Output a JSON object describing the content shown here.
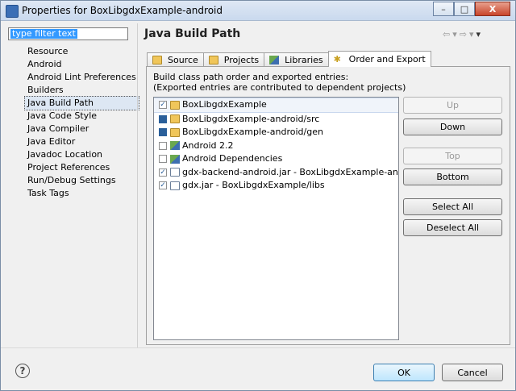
{
  "window": {
    "title": "Properties for BoxLibgdxExample-android",
    "controls": {
      "minimize": "–",
      "maximize": "□",
      "close": "X"
    }
  },
  "filter": {
    "value": "type filter text"
  },
  "nav": {
    "items": [
      {
        "label": "Resource"
      },
      {
        "label": "Android"
      },
      {
        "label": "Android Lint Preferences"
      },
      {
        "label": "Builders"
      },
      {
        "label": "Java Build Path",
        "selected": true
      },
      {
        "label": "Java Code Style"
      },
      {
        "label": "Java Compiler"
      },
      {
        "label": "Java Editor"
      },
      {
        "label": "Javadoc Location"
      },
      {
        "label": "Project References"
      },
      {
        "label": "Run/Debug Settings"
      },
      {
        "label": "Task Tags"
      }
    ]
  },
  "page": {
    "title": "Java Build Path",
    "history": {
      "back": "⇦",
      "back_menu": "▾",
      "forward": "⇨",
      "forward_menu": "▾",
      "view_menu": "▾"
    }
  },
  "tabs": [
    {
      "label": "Source",
      "icon": "source-folder-icon"
    },
    {
      "label": "Projects",
      "icon": "projects-icon"
    },
    {
      "label": "Libraries",
      "icon": "libraries-icon"
    },
    {
      "label": "Order and Export",
      "icon": "order-export-icon",
      "active": true
    }
  ],
  "panel": {
    "desc_line1": "Build class path order and exported entries:",
    "desc_line2": "(Exported entries are contributed to dependent projects)"
  },
  "entries": [
    {
      "label": "BoxLibgdxExample",
      "check": "checked",
      "icon": "project-folder-icon"
    },
    {
      "label": "BoxLibgdxExample-android/src",
      "check": "grayed",
      "icon": "source-folder-icon"
    },
    {
      "label": "BoxLibgdxExample-android/gen",
      "check": "grayed",
      "icon": "source-folder-icon"
    },
    {
      "label": "Android 2.2",
      "check": "unchecked",
      "icon": "library-icon"
    },
    {
      "label": "Android Dependencies",
      "check": "unchecked",
      "icon": "library-icon"
    },
    {
      "label": "gdx-backend-android.jar - BoxLibgdxExample-android/libs",
      "check": "checked",
      "icon": "jar-icon"
    },
    {
      "label": "gdx.jar - BoxLibgdxExample/libs",
      "check": "checked",
      "icon": "jar-icon"
    }
  ],
  "buttons": {
    "up": "Up",
    "down": "Down",
    "top": "Top",
    "bottom": "Bottom",
    "select_all": "Select All",
    "deselect_all": "Deselect All"
  },
  "footer": {
    "help": "?",
    "ok": "OK",
    "cancel": "Cancel"
  },
  "colors": {
    "selection": "#3399ff",
    "checkbox": "#2a5f9a",
    "ok_border": "#3c7fb1"
  }
}
